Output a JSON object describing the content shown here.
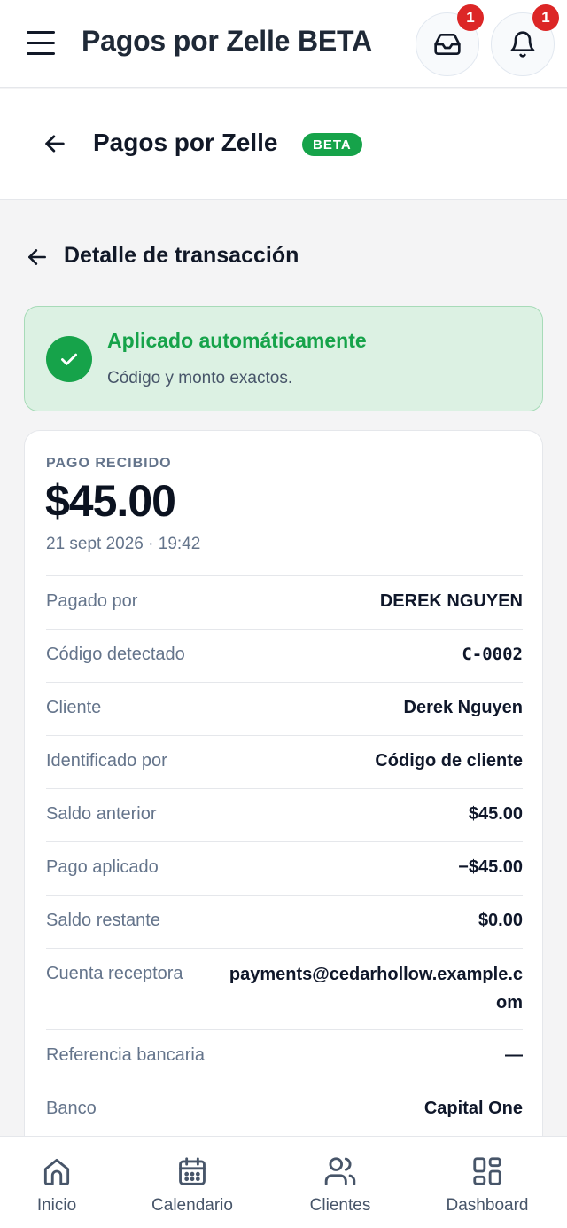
{
  "topbar": {
    "title": "Pagos por Zelle BETA",
    "inbox_badge": "1",
    "notifications_badge": "1"
  },
  "subheader": {
    "title": "Pagos por Zelle",
    "badge": "BETA"
  },
  "section": {
    "title": "Detalle de transacción"
  },
  "status": {
    "title": "Aplicado automáticamente",
    "description": "Código y monto exactos.",
    "color": "#16a34a"
  },
  "payment": {
    "label": "PAGO RECIBIDO",
    "amount": "$45.00",
    "datetime": "21 sept 2026 · 19:42",
    "rows": [
      {
        "label": "Pagado por",
        "value": "DEREK NGUYEN"
      },
      {
        "label": "Código detectado",
        "value": "C-0002"
      },
      {
        "label": "Cliente",
        "value": "Derek Nguyen"
      },
      {
        "label": "Identificado por",
        "value": "Código de cliente"
      },
      {
        "label": "Saldo anterior",
        "value": "$45.00"
      },
      {
        "label": "Pago aplicado",
        "value": "−$45.00"
      },
      {
        "label": "Saldo restante",
        "value": "$0.00"
      },
      {
        "label": "Cuenta receptora",
        "value": "payments@cedarhollow.example.com"
      },
      {
        "label": "Referencia bancaria",
        "value": "—"
      },
      {
        "label": "Banco",
        "value": "Capital One"
      }
    ]
  },
  "nav": {
    "items": [
      {
        "label": "Inicio",
        "icon": "home-icon"
      },
      {
        "label": "Calendario",
        "icon": "calendar-icon"
      },
      {
        "label": "Clientes",
        "icon": "users-icon"
      },
      {
        "label": "Dashboard",
        "icon": "dashboard-icon"
      }
    ]
  }
}
